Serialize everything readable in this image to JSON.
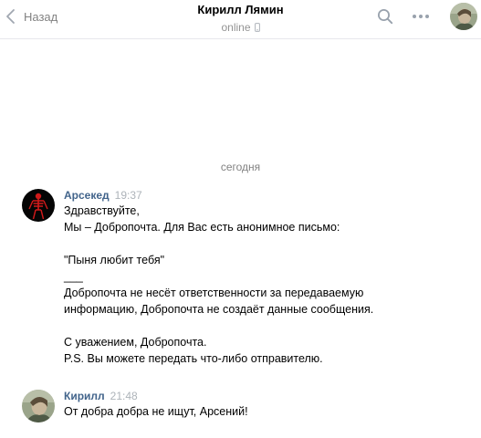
{
  "header": {
    "back_label": "Назад",
    "title": "Кирилл Лямин",
    "status": "online"
  },
  "chat": {
    "date_separator": "сегодня",
    "messages": [
      {
        "author": "Арсекед",
        "time": "19:37",
        "lines": [
          "Здравствуйте,",
          "Мы – Добропочта. Для Вас есть анонимное письмо:",
          "",
          "\"Пыня любит тебя\"",
          "___",
          "Добропочта не несёт ответственности за передаваемую",
          "информацию, Добропочта не создаёт данные сообщения.",
          "",
          "С уважением, Добропочта.",
          "P.S. Вы можете передать что-либо отправителю."
        ]
      },
      {
        "author": "Кирилл",
        "time": "21:48",
        "lines": [
          "От добра добра не ищут, Арсений!"
        ]
      }
    ]
  },
  "icons": {
    "back": "chevron-left-icon",
    "phone": "phone-icon",
    "search": "search-icon",
    "more": "more-icon"
  },
  "colors": {
    "accent": "#42648b",
    "muted": "#828282",
    "time": "#adb3b9",
    "divider": "#e7e8ec"
  }
}
